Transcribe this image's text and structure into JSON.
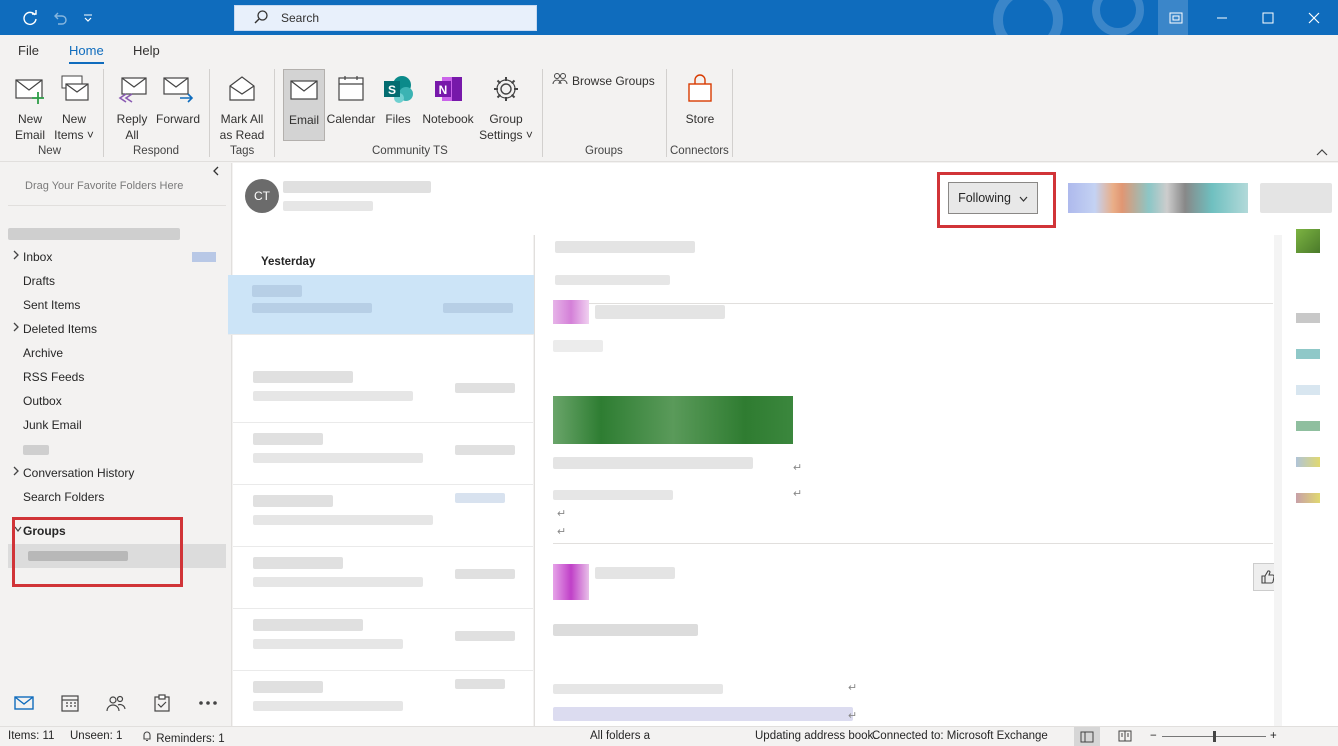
{
  "titlebar": {
    "search_placeholder": "Search",
    "icons": [
      "sync-icon",
      "undo-icon",
      "customize-icon",
      "restore-window-icon",
      "minimize-icon",
      "maximize-icon",
      "close-icon"
    ]
  },
  "menu": {
    "tabs": [
      "File",
      "Home",
      "Help"
    ],
    "active": "Home"
  },
  "ribbon": {
    "buttons": {
      "new_email": "New\nEmail",
      "new_items": "New\nItems ˅",
      "reply_all": "Reply\nAll",
      "forward": "Forward",
      "mark_all_read": "Mark All\nas Read",
      "email": "Email",
      "calendar": "Calendar",
      "files": "Files",
      "notebook": "Notebook",
      "group_settings": "Group\nSettings ˅",
      "browse_groups": "Browse Groups",
      "store": "Store"
    },
    "groups": {
      "new": "New",
      "respond": "Respond",
      "tags": "Tags",
      "community": "Community TS",
      "groups": "Groups",
      "connectors": "Connectors"
    }
  },
  "folderpane": {
    "drag_hint": "Drag Your Favorite Folders Here",
    "folders": [
      {
        "label": "Inbox",
        "chevron": true
      },
      {
        "label": "Drafts",
        "chevron": false
      },
      {
        "label": "Sent Items",
        "chevron": false
      },
      {
        "label": "Deleted Items",
        "chevron": true
      },
      {
        "label": "Archive",
        "chevron": false
      },
      {
        "label": "RSS Feeds",
        "chevron": false
      },
      {
        "label": "Outbox",
        "chevron": false
      },
      {
        "label": "Junk Email",
        "chevron": false
      },
      {
        "label": "Conversation History",
        "chevron": true
      },
      {
        "label": "Search Folders",
        "chevron": false
      }
    ],
    "groups_label": "Groups"
  },
  "messagelist": {
    "avatar_initials": "CT",
    "date_header": "Yesterday"
  },
  "reading": {
    "following_label": "Following"
  },
  "statusbar": {
    "items": "Items: 11",
    "unseen": "Unseen: 1",
    "reminders": "Reminders: 1",
    "all_folders": "All folders a",
    "updating": "Updating address book.",
    "connected": "Connected to: Microsoft Exchange"
  },
  "colors": {
    "titlebar": "#0f6cbd",
    "highlight_box": "#d13438",
    "selected_row": "#cce4f7"
  }
}
